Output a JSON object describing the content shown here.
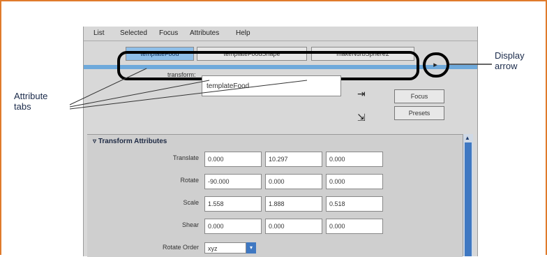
{
  "menu": [
    "List",
    "Selected",
    "Focus",
    "Attributes",
    "Help"
  ],
  "tabs": [
    "templateFood",
    "templateFoodShape",
    "makeNurbSphere2"
  ],
  "display_arrow_glyph": "▸",
  "transform_label": "transform:",
  "name_value": "templateFood",
  "buttons": {
    "focus": "Focus",
    "presets": "Presets"
  },
  "section_title": "Transform Attributes",
  "rows": [
    {
      "label": "Translate",
      "values": [
        "0.000",
        "10.297",
        "0.000"
      ]
    },
    {
      "label": "Rotate",
      "values": [
        "-90.000",
        "0.000",
        "0.000"
      ]
    },
    {
      "label": "Scale",
      "values": [
        "1.558",
        "1.888",
        "0.518"
      ]
    },
    {
      "label": "Shear",
      "values": [
        "0.000",
        "0.000",
        "0.000"
      ]
    }
  ],
  "rotate_order": {
    "label": "Rotate Order",
    "value": "xyz"
  },
  "callouts": {
    "attribute_tabs": [
      "Attribute",
      "tabs"
    ],
    "display_arrow": [
      "Display",
      "arrow"
    ]
  },
  "colors": {
    "frame": "#e07b2c",
    "active_tab": "#8fbfe9",
    "scroll_thumb": "#3f78c2"
  }
}
